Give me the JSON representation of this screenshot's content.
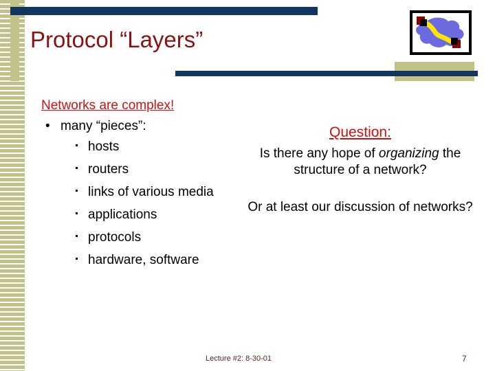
{
  "slide": {
    "title": "Protocol “Layers”",
    "accent_blue": "#11365f",
    "accent_tan": "#c3c18a",
    "title_color": "#8a1212",
    "highlight_red": "#cc1111",
    "footer_color": "#5a2020"
  },
  "logo": {
    "name": "network-cloud-icon",
    "cloud_color": "#6b6bdf",
    "link_color": "#ffe600",
    "node_color": "#000000",
    "node_accent": "#8b0000",
    "frame_color": "#000000"
  },
  "left_column": {
    "headline": "Networks are complex!",
    "bullet_glyph": "•",
    "items": [
      {
        "label": "many “pieces”:",
        "sub_items": [
          "hosts",
          "routers",
          "links of various media",
          "applications",
          "protocols",
          "hardware, software"
        ]
      }
    ]
  },
  "right_column": {
    "label": "Question:",
    "question_part1": "Is there any hope of ",
    "question_emphasis": "organizing",
    "question_part2": " the structure of a network?",
    "followup": "Or at least our discussion of networks?"
  },
  "footer": {
    "lecture": "Lecture #2: 8-30-01",
    "page_number": "7"
  }
}
